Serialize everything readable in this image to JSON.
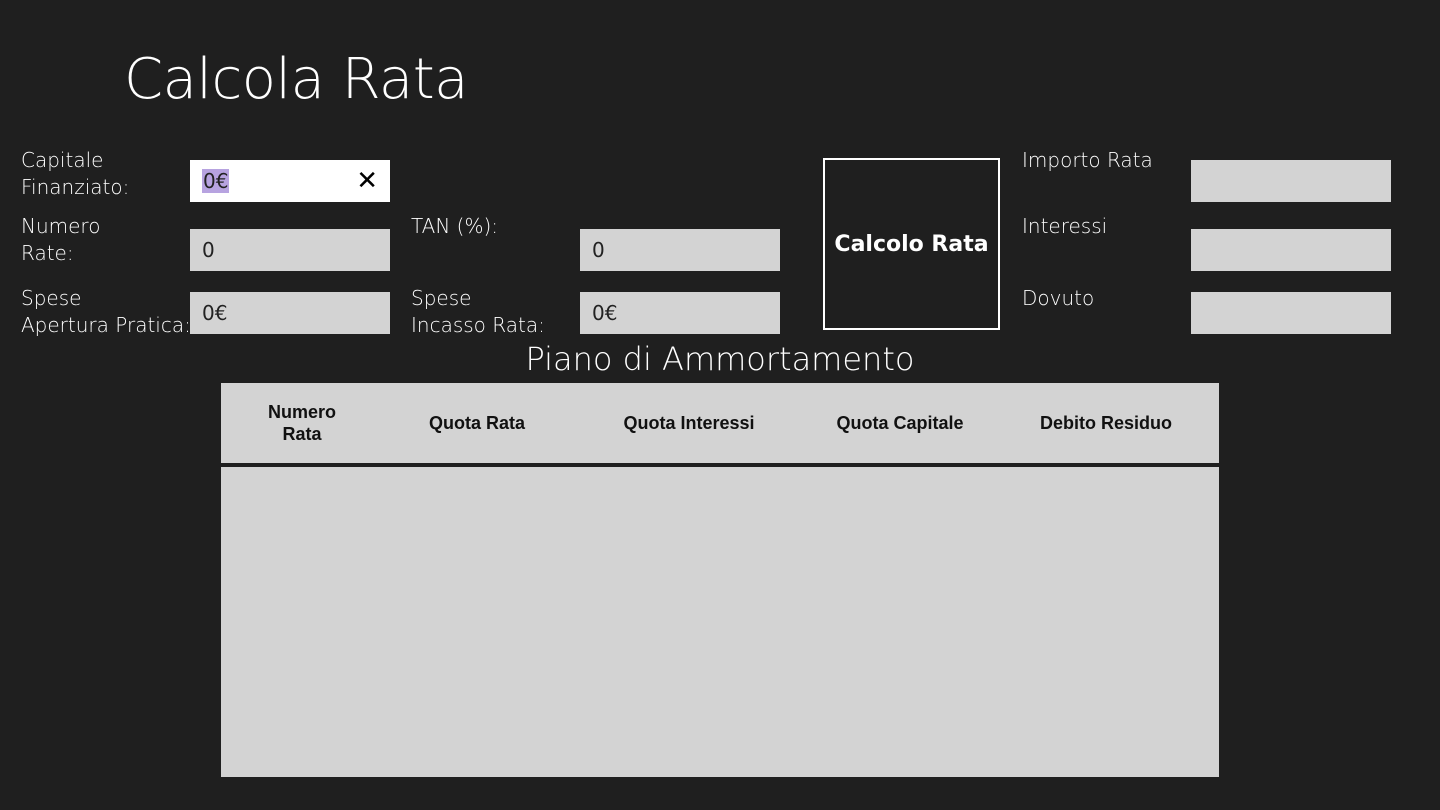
{
  "app": {
    "title": "Calcola Rata"
  },
  "form": {
    "capitale": {
      "label1": "Capitale",
      "label2": "Finanziato:",
      "value": "0€"
    },
    "numero_rate": {
      "label1": "Numero",
      "label2": "Rate:",
      "value": "0"
    },
    "tan": {
      "label": "TAN (%):",
      "value": "0"
    },
    "spese_apertura": {
      "label1": "Spese",
      "label2": "Apertura Pratica:",
      "value": "0€"
    },
    "spese_incasso": {
      "label1": "Spese",
      "label2": "Incasso Rata:",
      "value": "0€"
    }
  },
  "calc_button": {
    "label": "Calcolo Rata"
  },
  "results": {
    "importo_rata": {
      "label": "Importo Rata",
      "value": ""
    },
    "interessi": {
      "label": "Interessi",
      "value": ""
    },
    "dovuto": {
      "label": "Dovuto",
      "value": ""
    }
  },
  "piano": {
    "title": "Piano di Ammortamento",
    "columns": {
      "numero_rata_1": "Numero",
      "numero_rata_2": "Rata",
      "quota_rata": "Quota Rata",
      "quota_interessi": "Quota Interessi",
      "quota_capitale": "Quota Capitale",
      "debito_residuo": "Debito Residuo"
    },
    "rows": []
  },
  "icons": {
    "clear": "close-icon"
  }
}
